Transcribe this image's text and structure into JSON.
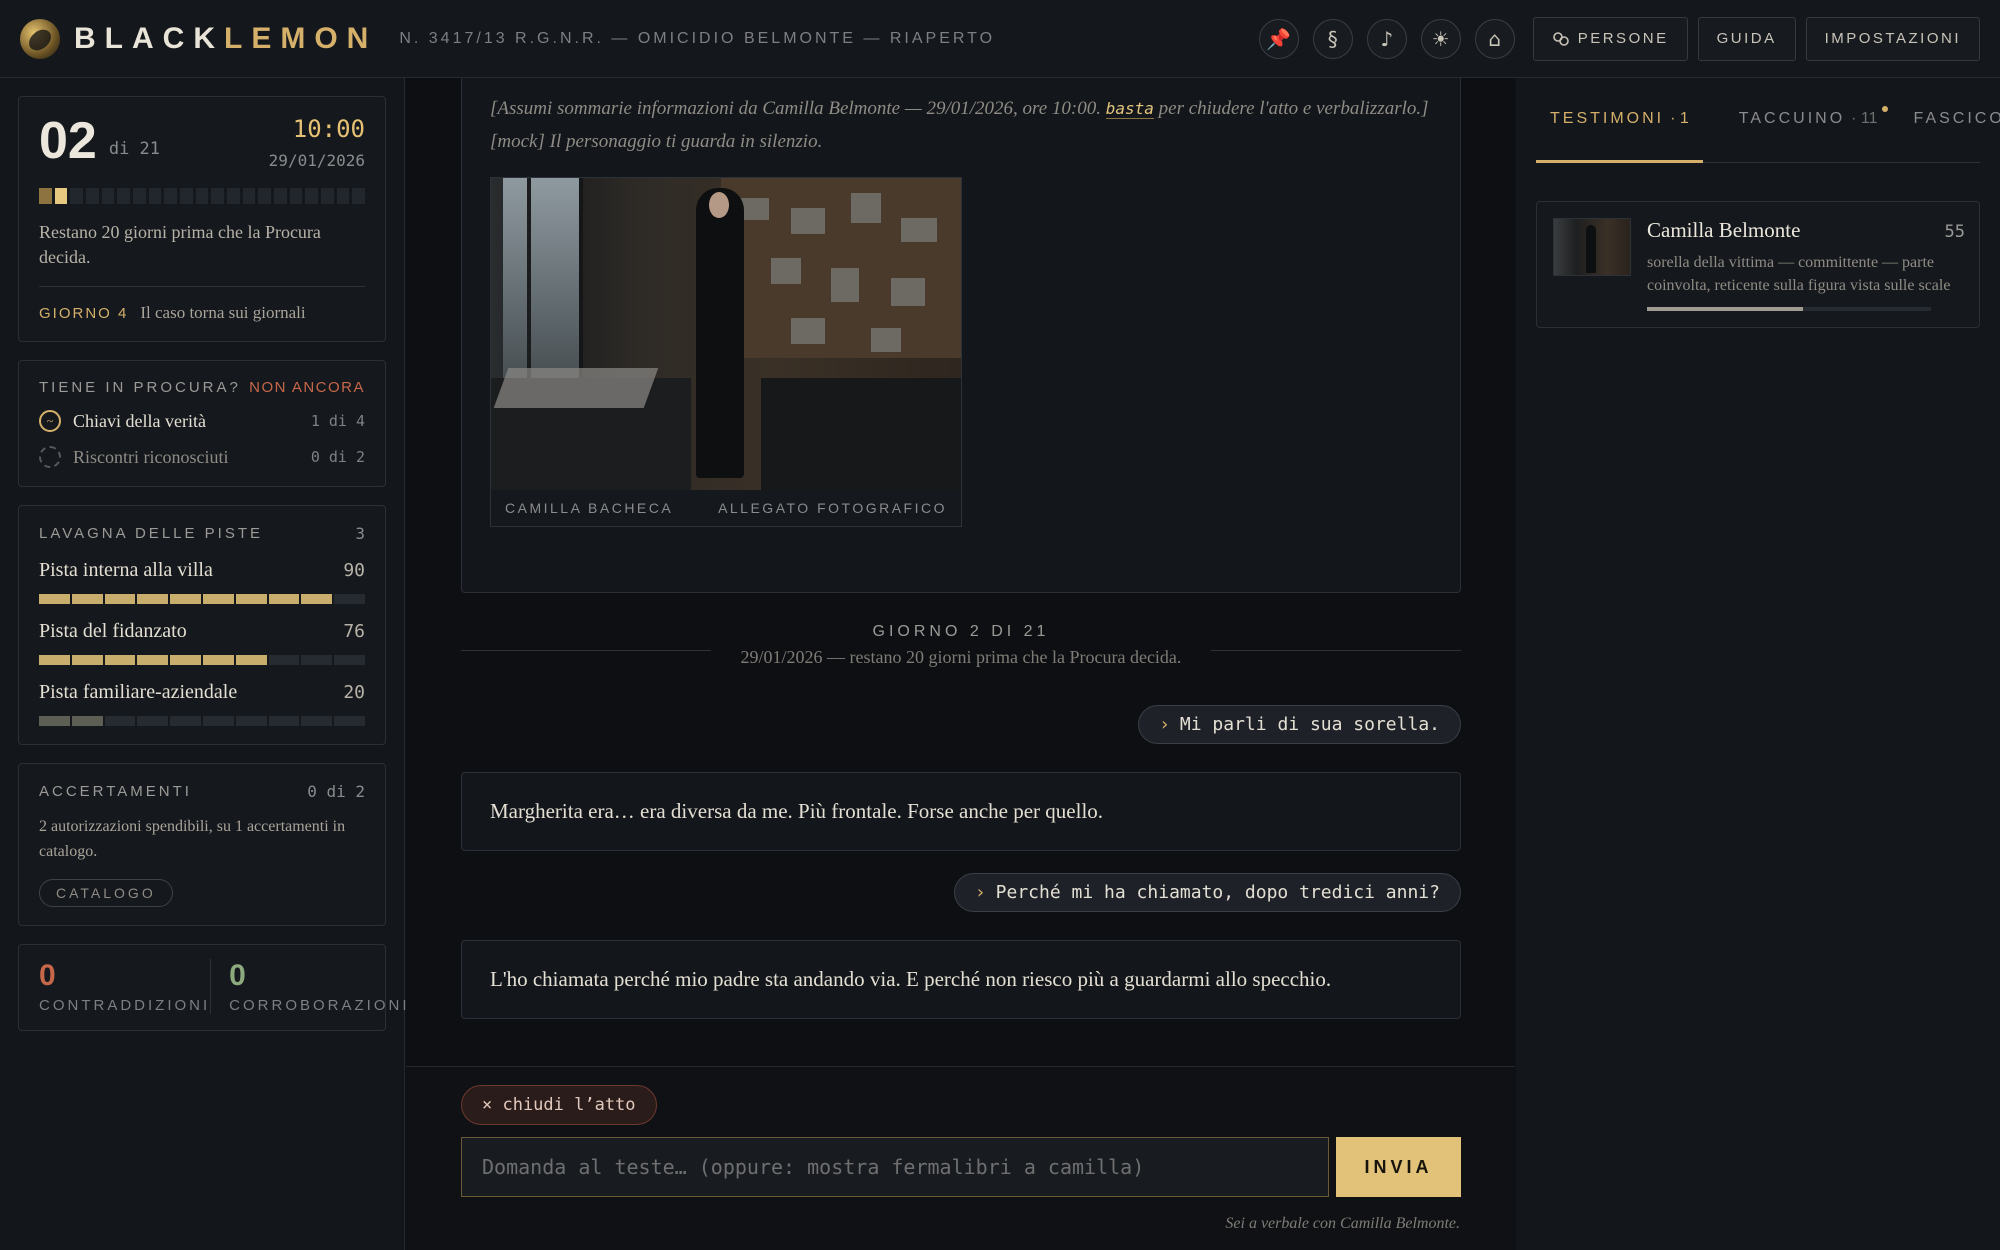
{
  "header": {
    "brand_a": "BLACK",
    "brand_b": "LEMON",
    "case_ref": "N. 3417/13 R.G.N.R. — OMICIDIO BELMONTE — RIAPERTO",
    "icons": [
      {
        "name": "pin-icon",
        "glyph": "📌"
      },
      {
        "name": "section-icon",
        "glyph": "§"
      },
      {
        "name": "music-icon",
        "glyph": "♪"
      },
      {
        "name": "brightness-icon",
        "glyph": "☀"
      },
      {
        "name": "home-icon",
        "glyph": "⌂"
      }
    ],
    "nav": {
      "persone": "PERSONE",
      "guida": "GUIDA",
      "impostazioni": "IMPOSTAZIONI"
    }
  },
  "status": {
    "day": "02",
    "of": "di 21",
    "time": "10:00",
    "date": "29/01/2026",
    "days_total": 21,
    "days_done": 1,
    "current_day": 2,
    "remain": "Restano 20 giorni prima che la Procura decida.",
    "event_tag": "GIORNO 4",
    "event_text": "Il caso torna sui giornali"
  },
  "procura": {
    "title": "TIENE IN PROCURA?",
    "state": "NON ANCORA",
    "rows": [
      {
        "label": "Chiavi della verità",
        "value": "1 di 4"
      },
      {
        "label": "Riscontri riconosciuti",
        "value": "0 di 2"
      }
    ]
  },
  "lavagna": {
    "title": "LAVAGNA DELLE PISTE",
    "count": "3",
    "piste": [
      {
        "label": "Pista interna alla villa",
        "score": "90",
        "level": 0.9
      },
      {
        "label": "Pista del fidanzato",
        "score": "76",
        "level": 0.76
      },
      {
        "label": "Pista familiare-aziendale",
        "score": "20",
        "level": 0.2
      }
    ]
  },
  "accertamenti": {
    "title": "ACCERTAMENTI",
    "count": "0 di 2",
    "text": "2 autorizzazioni spendibili, su 1 accertamenti in catalogo.",
    "button": "CATALOGO"
  },
  "stats": {
    "contr_n": "0",
    "contr_label": "CONTRADDIZIONI",
    "corr_n": "0",
    "corr_label": "CORROBORAZIONI"
  },
  "feed": {
    "scene_a": "[Assumi sommarie informazioni da Camilla Belmonte — 29/01/2026, ore 10:00.",
    "scene_kw": "basta",
    "scene_b": "per chiudere l'atto e verbalizzarlo.]",
    "scene_mock": "[mock] Il personaggio ti guarda in silenzio.",
    "photo_caption_left": "CAMILLA BACHECA",
    "photo_caption_right": "ALLEGATO FOTOGRAFICO",
    "day_sep_title": "GIORNO 2 DI 21",
    "day_sep_sub": "29/01/2026 — restano 20 giorni prima che la Procura decida.",
    "q1": "Mi parli di sua sorella.",
    "a1": "Margherita era… era diversa da me. Più frontale. Forse anche per quello.",
    "q2": "Perché mi ha chiamato, dopo tredici anni?",
    "a2": "L'ho chiamata perché mio padre sta andando via. E perché non riesco più a guardarmi allo specchio.",
    "arrow": "›"
  },
  "composer": {
    "close": "× chiudi l’atto",
    "placeholder": "Domanda al teste… (oppure: mostra fermalibri a camilla)",
    "send": "INVIA",
    "note": "Sei a verbale con Camilla Belmonte."
  },
  "right": {
    "tabs": [
      {
        "label": "TESTIMONI",
        "count": "· 1"
      },
      {
        "label": "TACCUINO",
        "count": "· 11"
      },
      {
        "label": "FASCICOLO",
        "count": ""
      }
    ],
    "witness": {
      "name": "Camilla Belmonte",
      "score": "55",
      "desc": "sorella della vittima — committente — parte coinvolta, reticente sulla figura vista sulle scale",
      "level": 0.55
    }
  }
}
